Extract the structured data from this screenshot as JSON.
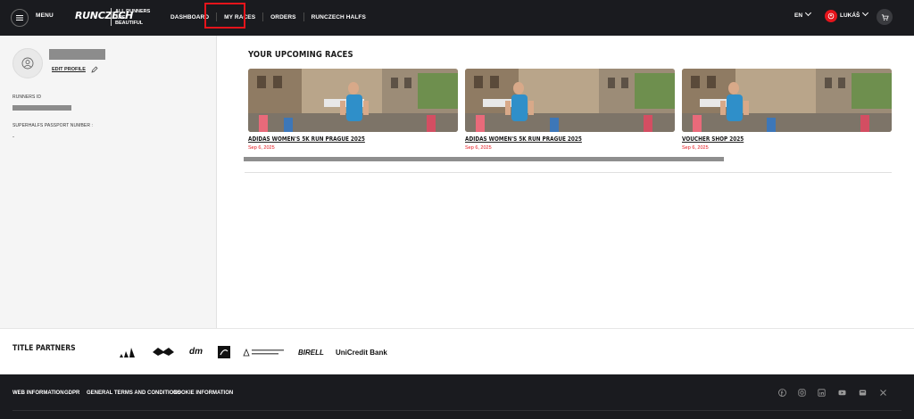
{
  "header": {
    "menu_label": "MENU",
    "logo_text": "RUNCZECH",
    "tagline": "ALL RUNNERS ARE BEAUTIFUL",
    "nav": [
      "DASHBOARD",
      "MY RACES",
      "ORDERS",
      "RUNCZECH HALFS"
    ],
    "active_nav": "MY RACES",
    "language": "EN",
    "user_name": "LUKÁŠ"
  },
  "sidebar": {
    "edit_profile": "EDIT PROFILE",
    "runners_id_label": "RUNNERS ID",
    "passport_label": "SUPERHALFS PASSPORT NUMBER :",
    "passport_value": "-"
  },
  "main": {
    "title": "YOUR UPCOMING RACES",
    "races": [
      {
        "title": "ADIDAS WOMEN'S 5K RUN PRAGUE 2025",
        "date": "Sep 6, 2025"
      },
      {
        "title": "ADIDAS WOMEN'S 5K RUN PRAGUE 2025",
        "date": "Sep 6, 2025"
      },
      {
        "title": "VOUCHER SHOP 2025",
        "date": "Sep 6, 2025"
      }
    ]
  },
  "partners": {
    "title": "TITLE PARTNERS",
    "logos": [
      "adidas",
      "CZ eagle",
      "dm",
      "ORLEN",
      "Gen. Finance",
      "BIRELL",
      "UniCredit Bank"
    ]
  },
  "footer": {
    "links": [
      "WEB INFORMATION",
      "GDPR",
      "GENERAL TERMS AND CONDITIONS",
      "COOKIE INFORMATION"
    ],
    "social": [
      "facebook-icon",
      "instagram-icon",
      "linkedin-icon",
      "youtube-icon",
      "strava-icon",
      "x-icon"
    ]
  },
  "colors": {
    "accent": "#e5141b",
    "header_bg": "#1a1b1f",
    "sidebar_bg": "#f5f5f5"
  }
}
